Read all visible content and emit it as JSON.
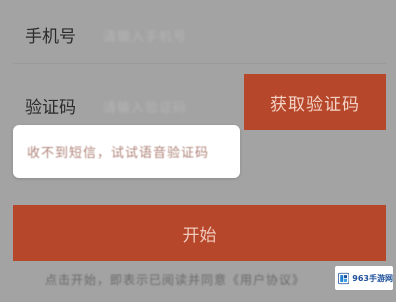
{
  "form": {
    "phone_label": "手机号",
    "phone_placeholder": "请输入手机号",
    "code_label": "验证码",
    "code_placeholder": "请输入验证码",
    "get_code_button": "获取验证码",
    "voice_tip": "收不到短信，试试语音验证码",
    "start_button": "开始",
    "agreement_text": "点击开始，即表示已阅读并同意《用户协议》"
  },
  "watermark": {
    "text": "963手游网"
  },
  "colors": {
    "accent": "#b7472b",
    "overlay_bg": "#a3a3a3"
  }
}
